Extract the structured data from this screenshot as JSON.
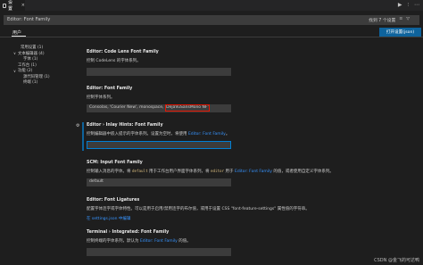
{
  "tab": {
    "label": "设置",
    "close": "×"
  },
  "title_actions": [
    "▶",
    "⫶",
    "⋯"
  ],
  "search": {
    "value": "Editor: Font Family",
    "result_count": "找到 7 个设置",
    "filter_icon": "▽",
    "clear_icon": "≡"
  },
  "scope": {
    "user": "用户",
    "open_json": "打开设置(json)"
  },
  "toc": [
    {
      "label": "常用设置 (1)",
      "indent": 2,
      "chevron": ""
    },
    {
      "label": "文本编辑器 (4)",
      "indent": 1,
      "chevron": "∨"
    },
    {
      "label": "字体 (1)",
      "indent": 3,
      "chevron": ""
    },
    {
      "label": "工作台 (1)",
      "indent": 1,
      "chevron": ""
    },
    {
      "label": "功能 (2)",
      "indent": 1,
      "chevron": "∨"
    },
    {
      "label": "源代码管理 (1)",
      "indent": 3,
      "chevron": ""
    },
    {
      "label": "终端 (1)",
      "indent": 3,
      "chevron": ""
    }
  ],
  "settings": [
    {
      "title": "Editor: Code Lens Font Family",
      "desc": "控制 CodeLens 的字体系列。",
      "value": ""
    },
    {
      "title": "Editor: Font Family",
      "desc": "控制字体系列。",
      "value": "Consolas, 'Courier New', monospace, 'DejaVuSansMono NF'"
    },
    {
      "title": "Editor › Inlay Hints: Font Family",
      "desc_pre": "控制编辑器中嵌入提示的字体系列。设置为空时，将使用 ",
      "desc_link": "Editor: Font Family",
      "desc_post": "。",
      "value": ""
    },
    {
      "title": "SCM: Input Font Family",
      "desc_pre": "控制输入消息的字体。将 ",
      "desc_code1": "default",
      "desc_mid": " 用于工作台用户界面字体系列，将 ",
      "desc_code2": "editor",
      "desc_mid2": " 用于 ",
      "desc_link": "Editor: Font Family",
      "desc_post": " 的值，或者使用自定义字体系列。",
      "value": "default"
    },
    {
      "title": "Editor: Font Ligatures",
      "desc": "配置字体连字或字体特性。可以是用于启用/禁用连字的布尔值，或用于设置 CSS \"font-feature-settings\" 属性值的字符串。",
      "link": "在 settings.json 中编辑"
    },
    {
      "title": "Terminal › Integrated: Font Family",
      "desc_pre": "控制终端的字体系列，默认为 ",
      "desc_link": "Editor: Font Family",
      "desc_post": " 的值。",
      "value": ""
    }
  ],
  "watermark": "CSDN @金飞的可达鸭"
}
